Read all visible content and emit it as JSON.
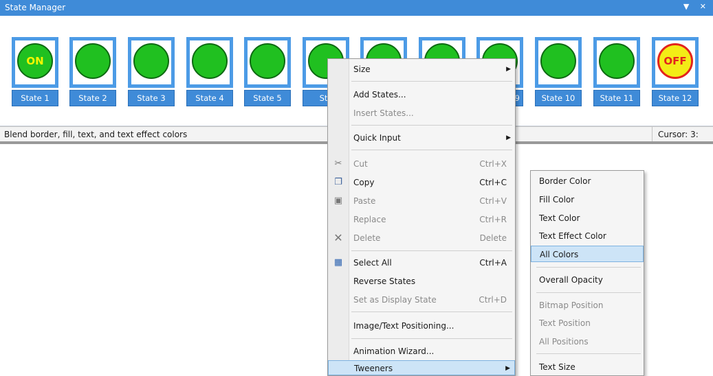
{
  "window": {
    "title": "State Manager",
    "controls": "▼ ✕"
  },
  "states": [
    {
      "label": "State 1",
      "text": "ON",
      "kind": "on"
    },
    {
      "label": "State 2",
      "text": "",
      "kind": "plain"
    },
    {
      "label": "State 3",
      "text": "",
      "kind": "plain"
    },
    {
      "label": "State 4",
      "text": "",
      "kind": "plain"
    },
    {
      "label": "State 5",
      "text": "",
      "kind": "plain"
    },
    {
      "label": "Sta",
      "text": "",
      "kind": "plain"
    },
    {
      "label": "",
      "text": "",
      "kind": "plain"
    },
    {
      "label": "",
      "text": "",
      "kind": "plain"
    },
    {
      "label": "9",
      "text": "",
      "kind": "plain"
    },
    {
      "label": "State 10",
      "text": "",
      "kind": "plain"
    },
    {
      "label": "State 11",
      "text": "",
      "kind": "plain"
    },
    {
      "label": "State 12",
      "text": "OFF",
      "kind": "off"
    }
  ],
  "status": {
    "message": "Blend border, fill, text, and text effect colors",
    "cursor": "Cursor: 3:"
  },
  "context_menu": {
    "items": [
      {
        "label": "Size",
        "shortcut": "",
        "submenu": true,
        "disabled": false,
        "icon": ""
      },
      {
        "label": "Add States...",
        "shortcut": "",
        "submenu": false,
        "disabled": false,
        "icon": ""
      },
      {
        "label": "Insert States...",
        "shortcut": "",
        "submenu": false,
        "disabled": true,
        "icon": ""
      },
      {
        "label": "Quick Input",
        "shortcut": "",
        "submenu": true,
        "disabled": false,
        "icon": ""
      },
      {
        "label": "Cut",
        "shortcut": "Ctrl+X",
        "submenu": false,
        "disabled": true,
        "icon": "scissors-icon"
      },
      {
        "label": "Copy",
        "shortcut": "Ctrl+C",
        "submenu": false,
        "disabled": false,
        "icon": "copy-icon"
      },
      {
        "label": "Paste",
        "shortcut": "Ctrl+V",
        "submenu": false,
        "disabled": true,
        "icon": "paste-icon"
      },
      {
        "label": "Replace",
        "shortcut": "Ctrl+R",
        "submenu": false,
        "disabled": true,
        "icon": ""
      },
      {
        "label": "Delete",
        "shortcut": "Delete",
        "submenu": false,
        "disabled": true,
        "icon": "delete-icon"
      },
      {
        "label": "Select All",
        "shortcut": "Ctrl+A",
        "submenu": false,
        "disabled": false,
        "icon": "select-all-icon"
      },
      {
        "label": "Reverse States",
        "shortcut": "",
        "submenu": false,
        "disabled": false,
        "icon": ""
      },
      {
        "label": "Set as Display State",
        "shortcut": "Ctrl+D",
        "submenu": false,
        "disabled": true,
        "icon": ""
      },
      {
        "label": "Image/Text Positioning...",
        "shortcut": "",
        "submenu": false,
        "disabled": false,
        "icon": ""
      },
      {
        "label": "Animation Wizard...",
        "shortcut": "",
        "submenu": false,
        "disabled": false,
        "icon": ""
      },
      {
        "label": "Tweeners",
        "shortcut": "",
        "submenu": true,
        "disabled": false,
        "icon": ""
      }
    ]
  },
  "tweeners_menu": {
    "items": [
      {
        "label": "Border Color",
        "disabled": false
      },
      {
        "label": "Fill Color",
        "disabled": false
      },
      {
        "label": "Text Color",
        "disabled": false
      },
      {
        "label": "Text Effect Color",
        "disabled": false
      },
      {
        "label": "All Colors",
        "disabled": false
      },
      {
        "label": "Overall Opacity",
        "disabled": false
      },
      {
        "label": "Bitmap Position",
        "disabled": true
      },
      {
        "label": "Text Position",
        "disabled": true
      },
      {
        "label": "All Positions",
        "disabled": true
      },
      {
        "label": "Text Size",
        "disabled": false
      }
    ]
  },
  "colors": {
    "titlebar": "#3f8bd8",
    "state_fill": "#20c020",
    "off_fill": "#f3ec16",
    "off_ring": "#e3241c",
    "on_text": "#f6f600",
    "highlight": "#cde4f7"
  }
}
